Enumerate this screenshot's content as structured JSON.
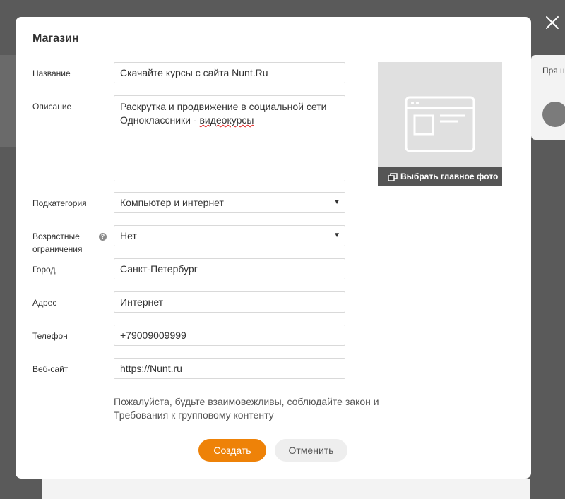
{
  "background": {
    "card_text": "Пря на са"
  },
  "modal": {
    "title": "Магазин",
    "fields": {
      "name": {
        "label": "Название",
        "value": "Скачайте курсы с сайта Nunt.Ru"
      },
      "description": {
        "label": "Описание",
        "value_main": "Раскрутка и продвижение в социальной сети Одноклассники - ",
        "value_misspelled": "видеокурсы"
      },
      "subcategory": {
        "label": "Подкатегория",
        "value": "Компьютер и интернет"
      },
      "age": {
        "label_line1": "Возрастные",
        "label_line2": "ограничения",
        "value": "Нет",
        "help": "?"
      },
      "city": {
        "label": "Город",
        "value": "Санкт-Петербург"
      },
      "address": {
        "label": "Адрес",
        "value": "Интернет"
      },
      "phone": {
        "label": "Телефон",
        "value": "+79009009999"
      },
      "website": {
        "label": "Веб-сайт",
        "value": "https://Nunt.ru"
      }
    },
    "photo": {
      "button_label": "Выбрать главное фото"
    },
    "notice": {
      "line1": "Пожалуйста, будьте взаимовежливы, соблюдайте закон и",
      "link": "Требования к групповому контенту"
    },
    "buttons": {
      "create": "Создать",
      "cancel": "Отменить"
    }
  },
  "colors": {
    "accent": "#ee8208",
    "overlay": "#5a5a5a"
  }
}
